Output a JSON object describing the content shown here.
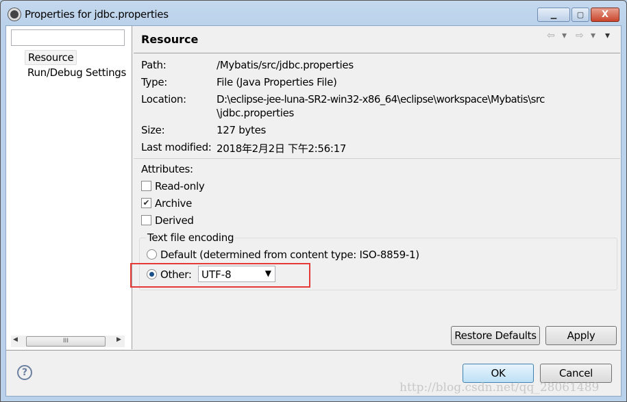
{
  "window": {
    "title": "Properties for jdbc.properties",
    "minimize": "▁",
    "maximize": "▢",
    "close": "X"
  },
  "sidebar": {
    "filter_placeholder": "",
    "items": [
      {
        "label": "Resource"
      },
      {
        "label": "Run/Debug Settings"
      }
    ],
    "scroll_thumb": "III"
  },
  "page": {
    "title": "Resource",
    "nav": {
      "back": "⇦",
      "back_menu": "▾",
      "forward": "⇨",
      "forward_menu": "▾",
      "view_menu": "▾"
    },
    "fields": [
      {
        "label": "Path:",
        "value": "/Mybatis/src/jdbc.properties"
      },
      {
        "label": "Type:",
        "value": "File  (Java Properties File)"
      },
      {
        "label": "Location:",
        "value": "D:\\eclipse-jee-luna-SR2-win32-x86_64\\eclipse\\workspace\\Mybatis\\src",
        "value2": "\\jdbc.properties"
      },
      {
        "label": "Size:",
        "value": "127  bytes"
      },
      {
        "label": "Last modified:",
        "value": "2018年2月2日 下午2:56:17"
      }
    ],
    "attributes_label": "Attributes:",
    "attributes": [
      {
        "label": "Read-only",
        "checked": false
      },
      {
        "label": "Archive",
        "checked": true
      },
      {
        "label": "Derived",
        "checked": false
      }
    ],
    "encoding": {
      "group_label": "Text file encoding",
      "default_label": "Default (determined from content type: ISO-8859-1)",
      "other_label": "Other:",
      "selected": "other",
      "value": "UTF-8"
    },
    "restore_defaults": "Restore Defaults",
    "apply": "Apply"
  },
  "footer": {
    "help": "?",
    "ok": "OK",
    "cancel": "Cancel"
  },
  "watermark": "http://blog.csdn.net/qq_28061489",
  "colors": {
    "highlight": "#e53935",
    "frame": "#b9d1ea"
  }
}
